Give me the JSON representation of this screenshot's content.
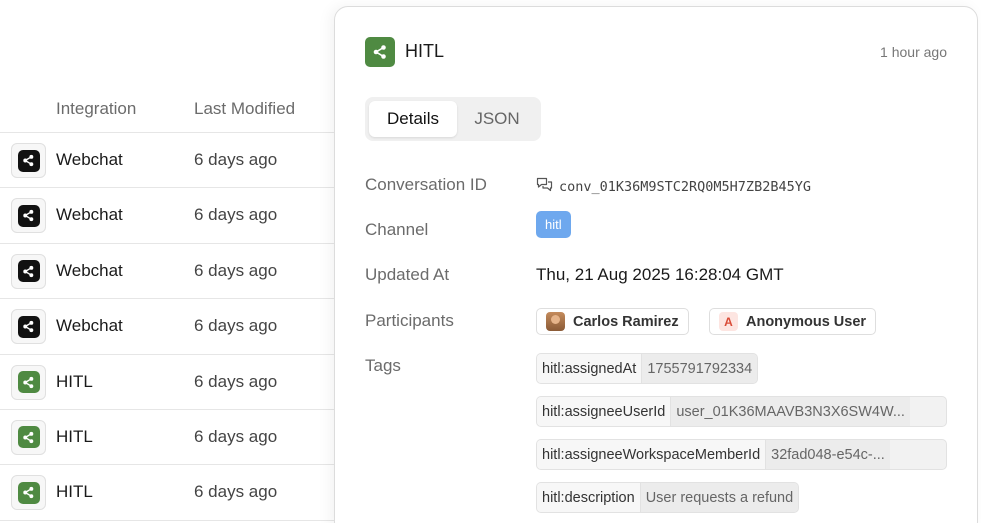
{
  "table": {
    "columns": {
      "integration": "Integration",
      "last_modified": "Last Modified"
    },
    "rows": [
      {
        "name": "Webchat",
        "time": "6 days ago",
        "icon": "share-icon",
        "color": "#111111"
      },
      {
        "name": "Webchat",
        "time": "6 days ago",
        "icon": "share-icon",
        "color": "#111111"
      },
      {
        "name": "Webchat",
        "time": "6 days ago",
        "icon": "share-icon",
        "color": "#111111"
      },
      {
        "name": "Webchat",
        "time": "6 days ago",
        "icon": "share-icon",
        "color": "#111111"
      },
      {
        "name": "HITL",
        "time": "6 days ago",
        "icon": "share-icon",
        "color": "#4f8a42"
      },
      {
        "name": "HITL",
        "time": "6 days ago",
        "icon": "share-icon",
        "color": "#4f8a42"
      },
      {
        "name": "HITL",
        "time": "6 days ago",
        "icon": "share-icon",
        "color": "#4f8a42"
      }
    ]
  },
  "panel": {
    "title": "HITL",
    "time": "1 hour ago",
    "tabs": {
      "details": "Details",
      "json": "JSON"
    },
    "labels": {
      "conversation_id": "Conversation ID",
      "channel": "Channel",
      "updated_at": "Updated At",
      "participants": "Participants",
      "tags": "Tags"
    },
    "conversation_id": "conv_01K36M9STC2RQ0M5H7ZB2B45YG",
    "channel": "hitl",
    "updated_at": "Thu, 21 Aug 2025 16:28:04 GMT",
    "participants": [
      {
        "name": "Carlos Ramirez"
      },
      {
        "name": "Anonymous User",
        "initial": "A"
      }
    ],
    "tags": [
      {
        "key": "hitl:assignedAt",
        "value": "1755791792334"
      },
      {
        "key": "hitl:assigneeUserId",
        "value": "user_01K36MAAVB3N3X6SW4W..."
      },
      {
        "key": "hitl:assigneeWorkspaceMemberId",
        "value": "32fad048-e54c-..."
      },
      {
        "key": "hitl:description",
        "value": "User requests a refund"
      }
    ]
  },
  "colors": {
    "hitl_green": "#4f8a42",
    "webchat_black": "#111111",
    "channel_blue": "#6ea8ee"
  }
}
